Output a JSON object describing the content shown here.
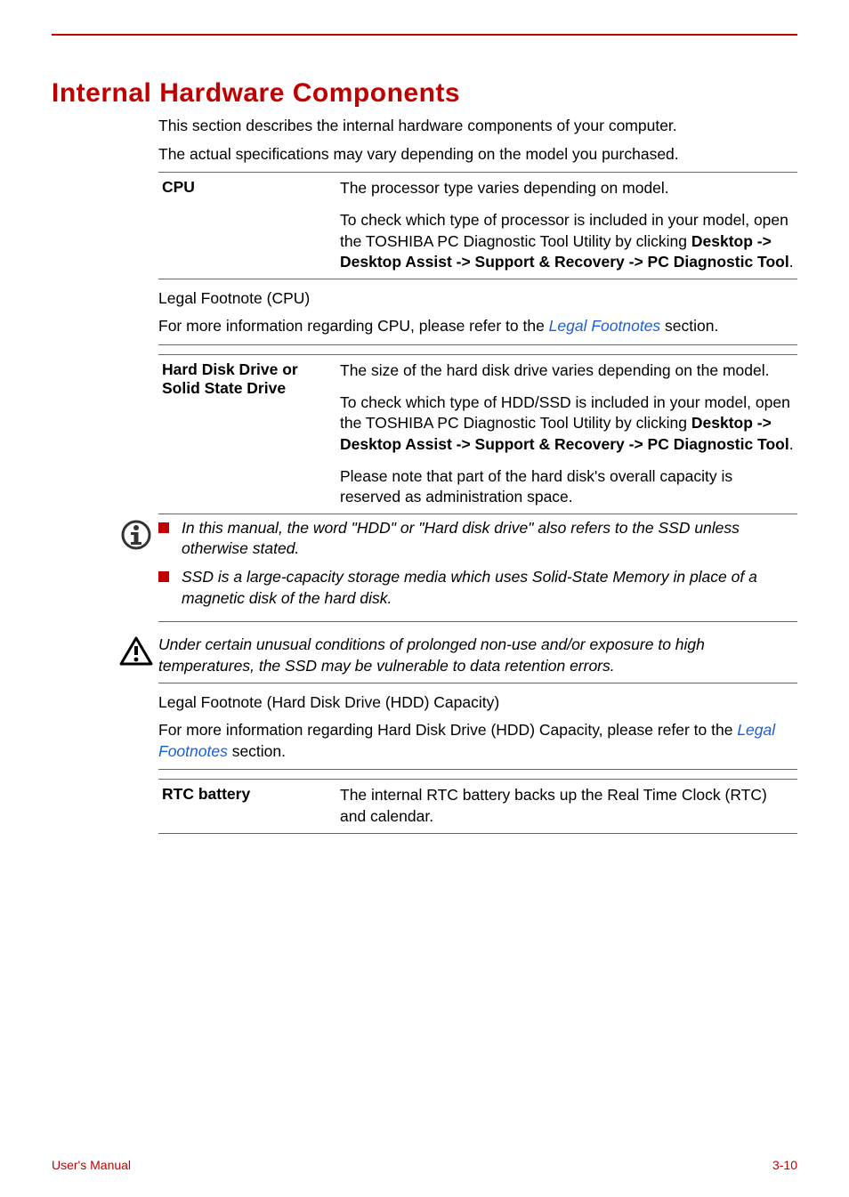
{
  "headings": {
    "section_title": "Internal Hardware Components"
  },
  "intro": {
    "p1": "This section describes the internal hardware components of your computer.",
    "p2": "The actual specifications may vary depending on the model you purchased."
  },
  "cpu": {
    "term": "CPU",
    "d1": "The processor type varies depending on model.",
    "d2a": "To check which type of processor is included in your model, open the TOSHIBA PC Diagnostic Tool Utility by clicking ",
    "d2b": "Desktop -> Desktop Assist -> Support & Recovery -> PC Diagnostic Tool",
    "d2c": "."
  },
  "cpu_note": {
    "t": "Legal Footnote (CPU)",
    "p_a": "For more information regarding CPU, please refer to the ",
    "link": "Legal Footnotes",
    "p_b": " section."
  },
  "hdd": {
    "term": "Hard Disk Drive or Solid State Drive",
    "d1": "The size of the hard disk drive varies depending on the model.",
    "d2a": "To check which type of HDD/SSD is included in your model, open the TOSHIBA PC Diagnostic Tool Utility by clicking ",
    "d2b": "Desktop -> Desktop Assist -> Support & Recovery -> PC Diagnostic Tool",
    "d2c": ".",
    "d3": "Please note that part of the hard disk's overall capacity is reserved as administration space."
  },
  "info_callout": {
    "b1": "In this manual, the word \"HDD\" or \"Hard disk drive\" also refers to the SSD unless otherwise stated.",
    "b2": "SSD is a large-capacity storage media which uses Solid-State Memory in place of a magnetic disk of the hard disk."
  },
  "warn_callout": {
    "msg": "Under certain unusual conditions of prolonged non-use and/or exposure to high temperatures, the SSD may be vulnerable to data retention errors."
  },
  "hdd_note": {
    "t": "Legal Footnote (Hard Disk Drive (HDD) Capacity)",
    "p_a": "For more information regarding Hard Disk Drive (HDD) Capacity, please refer to the ",
    "link": "Legal Footnotes",
    "p_b": " section."
  },
  "rtc": {
    "term": "RTC battery",
    "desc": "The internal RTC battery backs up the Real Time Clock (RTC) and calendar."
  },
  "footer": {
    "left": "User's Manual",
    "right": "3-10"
  }
}
